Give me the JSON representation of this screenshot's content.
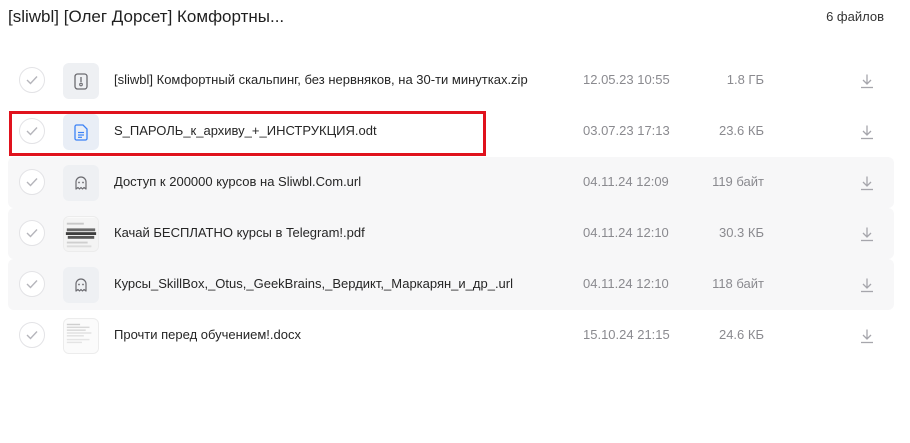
{
  "header": {
    "title": "[sliwbl] [Олег Дорсет] Комфортны...",
    "count": "6 файлов"
  },
  "files": [
    {
      "name": "[sliwbl] Комфортный скальпинг, без нервняков, на 30-ти минутках.zip",
      "date": "12.05.23 10:55",
      "size": "1.8 ГБ",
      "icon": "archive-icon"
    },
    {
      "name": "S_ПАРОЛЬ_к_архиву_+_ИНСТРУКЦИЯ.odt",
      "date": "03.07.23 17:13",
      "size": "23.6 КБ",
      "icon": "document-icon",
      "accent": "#3b82f6"
    },
    {
      "name": "Доступ к 200000 курсов на Sliwbl.Com.url",
      "date": "04.11.24 12:09",
      "size": "119 байт",
      "icon": "link-file-icon"
    },
    {
      "name": "Качай БЕСПЛАТНО курсы в Telegram!.pdf",
      "date": "04.11.24 12:10",
      "size": "30.3 КБ",
      "icon": "pdf-preview-icon"
    },
    {
      "name": "Курсы_SkillBox,_Otus,_GeekBrains,_Вердикт,_Маркарян_и_др_.url",
      "date": "04.11.24 12:10",
      "size": "118 байт",
      "icon": "link-file-icon"
    },
    {
      "name": "Прочти перед обучением!.docx",
      "date": "15.10.24 21:15",
      "size": "24.6 КБ",
      "icon": "docx-preview-icon"
    }
  ],
  "colors": {
    "highlight": "#e0121d",
    "muted_text": "#8a8a8f",
    "row_alt_bg": "#f7f7f8"
  }
}
